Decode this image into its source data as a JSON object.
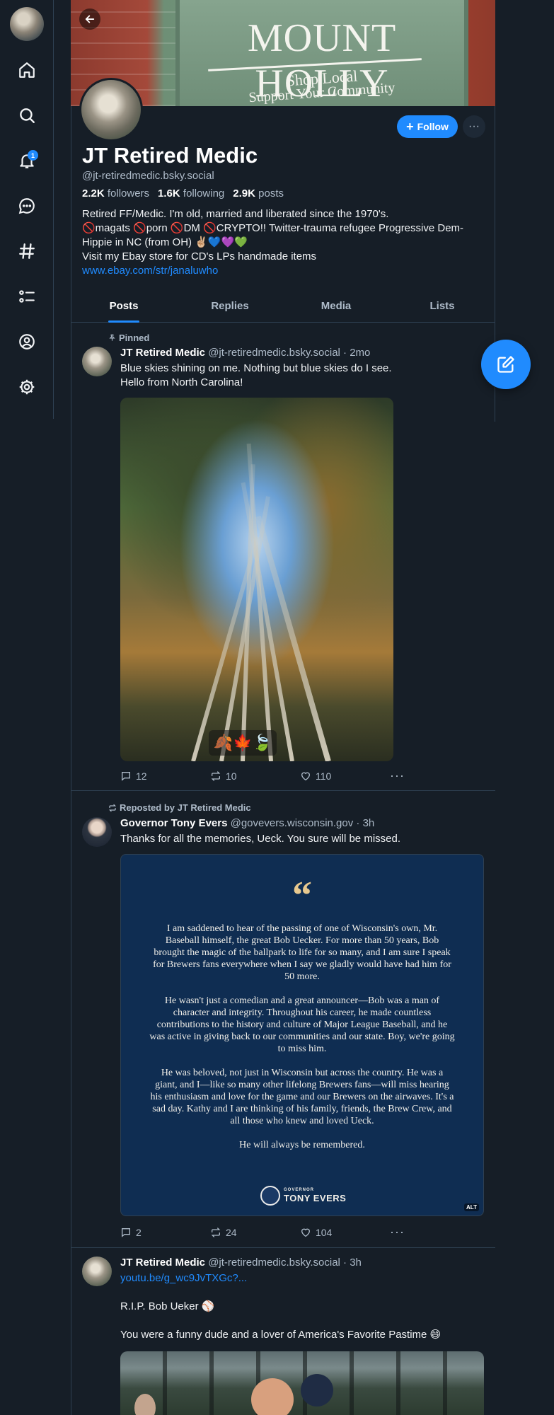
{
  "rail": {
    "notification_count": "1",
    "items": [
      "home",
      "search",
      "notifications",
      "chat",
      "feeds",
      "lists",
      "profile",
      "settings"
    ]
  },
  "banner": {
    "title": "MOUNT HOLLY",
    "line1": "Shop Local",
    "line2": "Support Your Community"
  },
  "profile": {
    "display_name": "JT Retired Medic",
    "handle": "@jt-retiredmedic.bsky.social",
    "followers_count": "2.2K",
    "followers_label": "followers",
    "following_count": "1.6K",
    "following_label": "following",
    "posts_count": "2.9K",
    "posts_label": "posts",
    "bio_line1": "Retired FF/Medic. I'm old, married and liberated since the 1970's.",
    "bio_line2": "🚫magats 🚫porn 🚫DM 🚫CRYPTO!! Twitter-trauma refugee Progressive Dem-Hippie in NC (from OH) ✌🏼💙💜💚",
    "bio_line3": "Visit my Ebay store for CD's LPs handmade items",
    "bio_link": "www.ebay.com/str/janaluwho",
    "follow_label": "Follow"
  },
  "tabs": [
    "Posts",
    "Replies",
    "Media",
    "Lists"
  ],
  "posts": [
    {
      "context": "Pinned",
      "author": "JT Retired Medic",
      "handle": "@jt-retiredmedic.bsky.social",
      "time": "· 2mo",
      "text_line1": "Blue skies shining on me. Nothing but blue skies do I see.",
      "text_line2": "Hello from North Carolina!",
      "image_emojis": "🍂🍁🍃",
      "replies": "12",
      "reposts": "10",
      "likes": "110"
    },
    {
      "context": "Reposted by JT Retired Medic",
      "author": "Governor Tony Evers",
      "handle": "@govevers.wisconsin.gov",
      "time": "· 3h",
      "text": "Thanks for all the memories, Ueck. You sure will be missed.",
      "quote_p1": "I am saddened to hear of the passing of one of Wisconsin's own, Mr. Baseball himself, the great Bob Uecker. For more than 50 years, Bob brought the magic of the ballpark to life for so many, and I am sure I speak for Brewers fans everywhere when I say we gladly would have had him for 50 more.",
      "quote_p2": "He wasn't just a comedian and a great announcer—Bob was a man of character and integrity. Throughout his career, he made countless contributions to the history and culture of Major League Baseball, and he was active in giving back to our communities and our state. Boy, we're going to miss him.",
      "quote_p3": "He was beloved, not just in Wisconsin but across the country. He was a giant, and I—like so many other lifelong Brewers fans—will miss hearing his enthusiasm and love for the game and our Brewers on the airwaves. It's a sad day. Kathy and I are thinking of his family, friends, the Brew Crew, and all those who knew and loved Ueck.",
      "quote_p4": "He will always be remembered.",
      "seal_small": "GOVERNOR",
      "seal_big": "TONY EVERS",
      "alt": "ALT",
      "replies": "2",
      "reposts": "24",
      "likes": "104"
    },
    {
      "author": "JT Retired Medic",
      "handle": "@jt-retiredmedic.bsky.social",
      "time": "· 3h",
      "link": "youtu.be/g_wc9JvTXGc?...",
      "text_line1": "R.I.P. Bob Ueker ⚾",
      "text_line2": "You were a funny dude and a lover of America's Favorite Pastime 😄"
    }
  ],
  "colors": {
    "background": "#161e27",
    "accent": "#208bfe",
    "border": "#2e4052",
    "muted_text": "#aebbc9",
    "quote_bg": "#0f2d52"
  }
}
